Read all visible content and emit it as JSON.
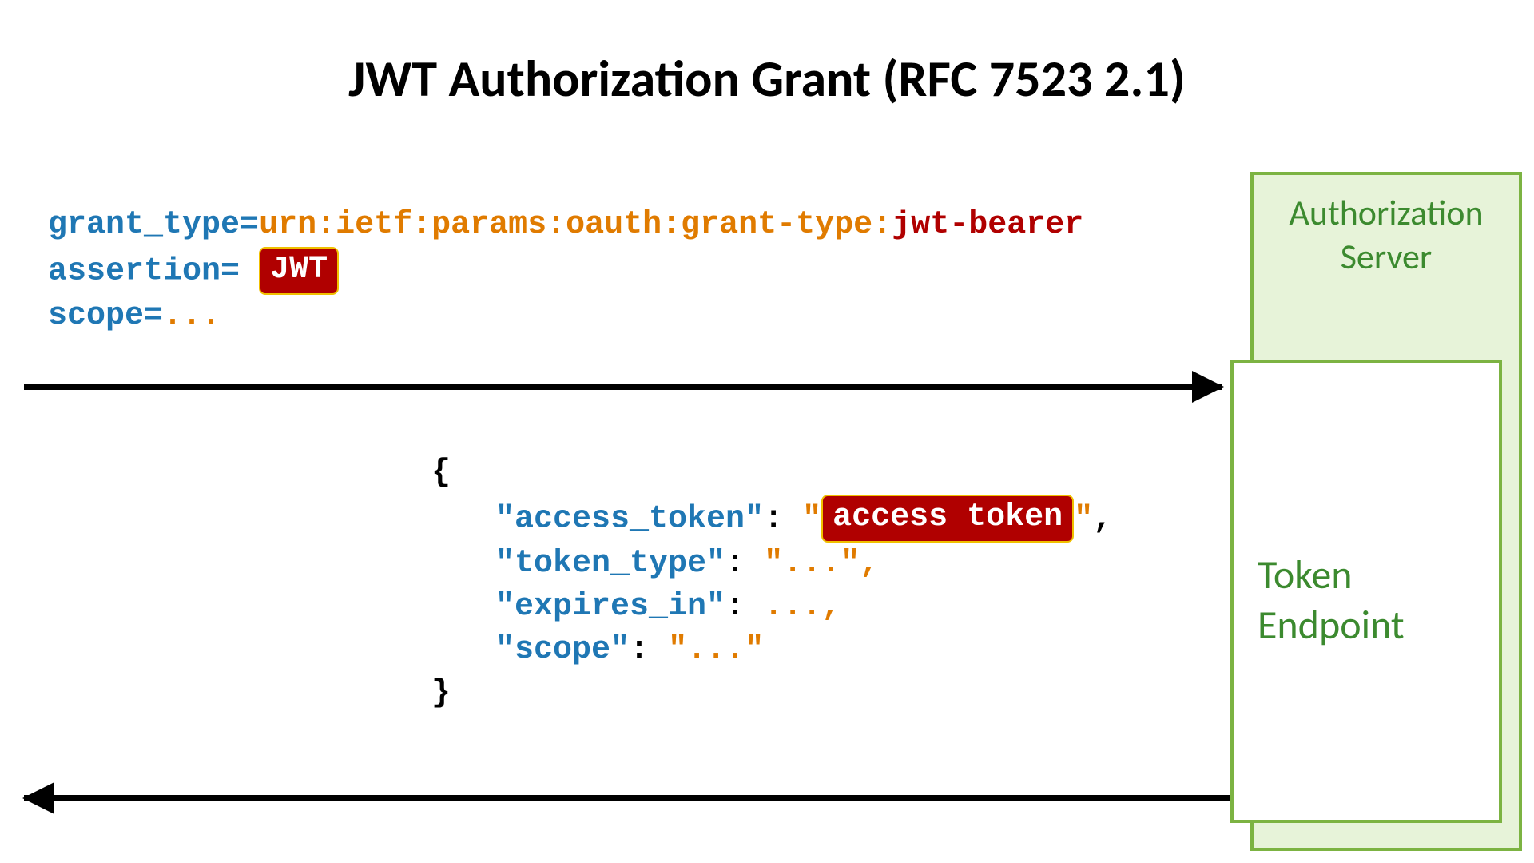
{
  "title": "JWT Authorization Grant (RFC 7523 2.1)",
  "request": {
    "p1_key": "grant_type",
    "p1_eq": "=",
    "p1_val_a": "urn:ietf:params:oauth:grant-type:",
    "p1_val_b": "jwt-bearer",
    "p2_key": "assertion",
    "p2_eq": "=",
    "p2_pill": "JWT",
    "p3_key": "scope",
    "p3_eq": "=",
    "p3_val": "..."
  },
  "response": {
    "open": "{",
    "access_token_key": "\"access_token\"",
    "colon": ":",
    "quote": "\"",
    "access_token_pill": "access token",
    "comma": ",",
    "close_q_comma": "\",",
    "token_type_key": "\"token_type\"",
    "token_type_val": "\"...\",",
    "expires_in_key": "\"expires_in\"",
    "expires_in_val": "...,",
    "scope_key": "\"scope\"",
    "scope_val": "\"...\"",
    "close": "}"
  },
  "server": {
    "auth_server": "Authorization Server",
    "token_endpoint": "Token Endpoint"
  }
}
